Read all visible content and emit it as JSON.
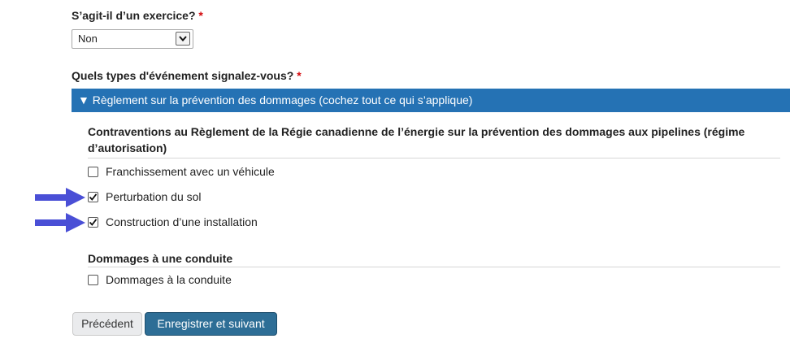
{
  "exercise": {
    "label": "S’agit-il d’un exercice?",
    "required_mark": "*",
    "select_value": "Non"
  },
  "event_types": {
    "label": "Quels types d'événement signalez-vous?",
    "required_mark": "*",
    "panel_title": "Règlement sur la prévention des dommages (cochez tout ce qui s’applique)",
    "panel_toggle": "▼"
  },
  "group1": {
    "heading": "Contraventions au Règlement de la Régie canadienne de l’énergie sur la prévention des dommages aux pipelines (régime d’autorisation)",
    "items": [
      {
        "label": "Franchissement avec un véhicule",
        "checked": false
      },
      {
        "label": "Perturbation du sol",
        "checked": true
      },
      {
        "label": "Construction d’une installation",
        "checked": true
      }
    ]
  },
  "group2": {
    "heading": "Dommages à une conduite",
    "items": [
      {
        "label": "Dommages à la conduite",
        "checked": false
      }
    ]
  },
  "buttons": {
    "previous": "Précédent",
    "save_next": "Enregistrer et suivant"
  },
  "colors": {
    "panel_header": "#2572b4",
    "primary_button": "#2e6e96",
    "required": "#d3080c",
    "annotation_arrow": "#4a4fd6"
  },
  "icons": {
    "arrow": "arrow-right-icon",
    "checkmark": "check-icon",
    "dropdown": "chevron-down-icon"
  }
}
